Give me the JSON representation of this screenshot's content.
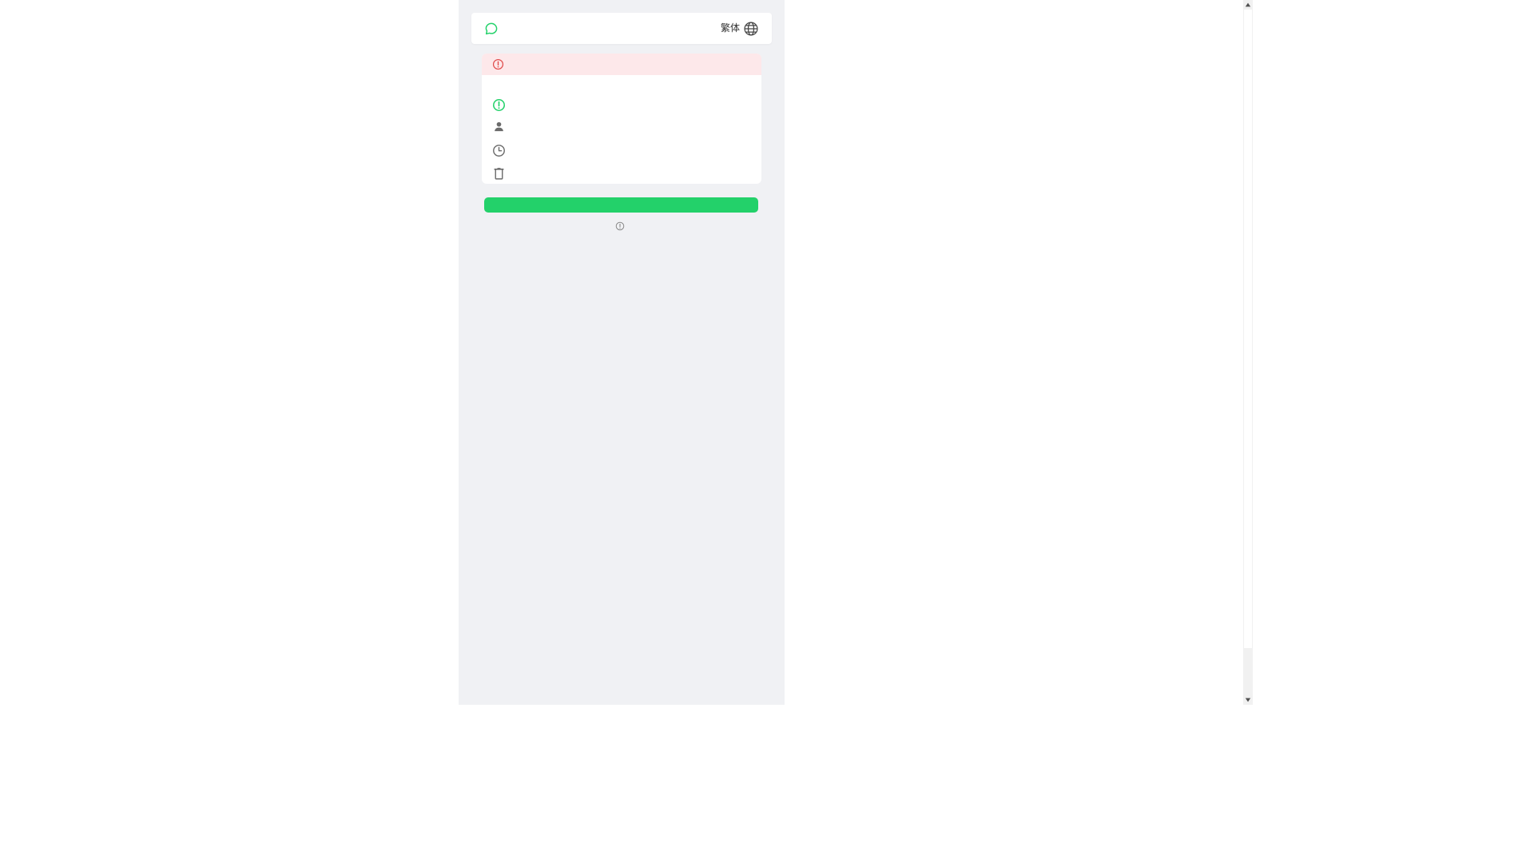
{
  "header": {
    "chat_icon": "chat-bubble-icon",
    "language_label": "繁体",
    "globe_icon": "globe-icon"
  },
  "alert": {
    "icon": "alert-circle-icon",
    "text": ""
  },
  "details": {
    "status_text": "",
    "user_text": "",
    "time_text": "",
    "copy_text": ""
  },
  "primary_button": {
    "label": ""
  },
  "footer": {
    "note_text": ""
  },
  "colors": {
    "accent_green": "#23d16a",
    "alert_bg": "#fde8ea",
    "alert_red": "#e04b4b",
    "page_bg": "#f0f1f4"
  }
}
